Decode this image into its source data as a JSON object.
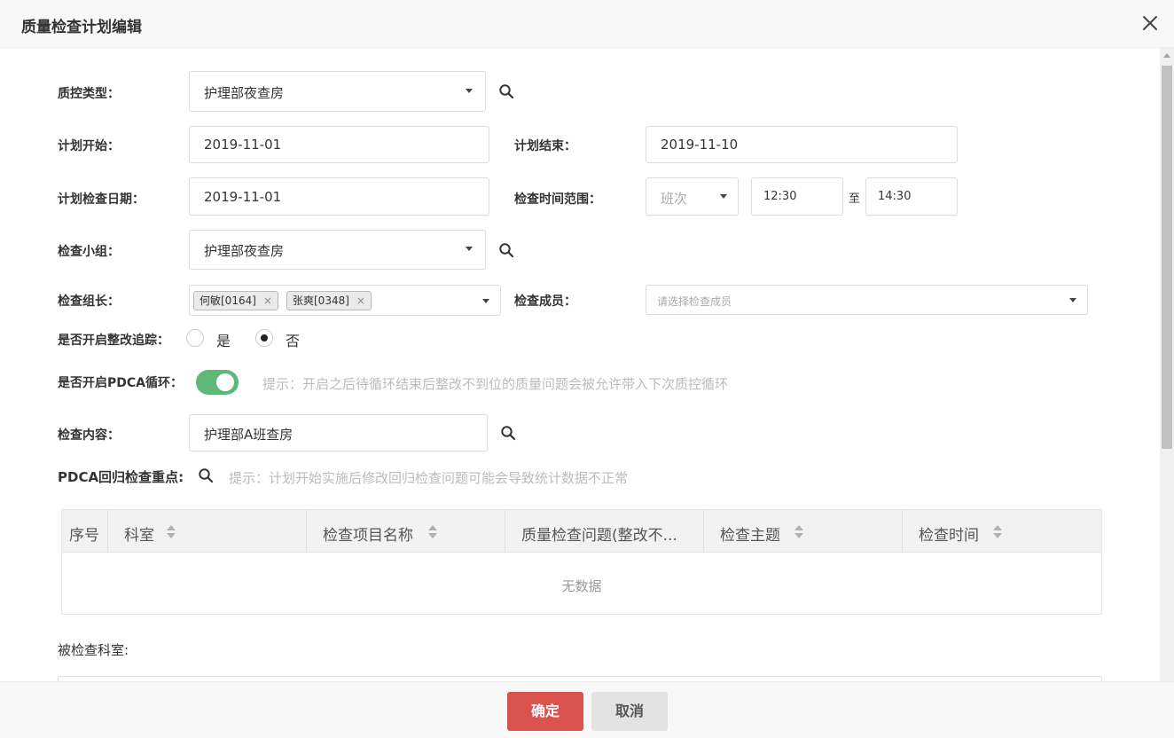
{
  "header": {
    "title": "质量检查计划编辑"
  },
  "form": {
    "qc_type": {
      "label": "质控类型：",
      "value": "护理部夜查房"
    },
    "plan_start": {
      "label": "计划开始：",
      "value": "2019-11-01"
    },
    "plan_end": {
      "label": "计划结束：",
      "value": "2019-11-10"
    },
    "plan_check_date": {
      "label": "计划检查日期：",
      "value": "2019-11-01"
    },
    "check_time_range": {
      "label": "检查时间范围：",
      "shift_placeholder": "班次",
      "start": "12:30",
      "separator": "至",
      "end": "14:30"
    },
    "check_group": {
      "label": "检查小组：",
      "value": "护理部夜查房"
    },
    "group_leader": {
      "label": "检查组长：",
      "tags": [
        "何敏[0164]",
        "张爽[0348]"
      ],
      "tag_remove": "×"
    },
    "group_members": {
      "label": "检查成员：",
      "placeholder": "请选择检查成员"
    },
    "rectify_tracking": {
      "label": "是否开启整改追踪：",
      "yes": "是",
      "no": "否",
      "selected": "no"
    },
    "pdca_cycle": {
      "label": "是否开启PDCA循环：",
      "enabled": true,
      "hint": "提示：开启之后待循环结束后整改不到位的质量问题会被允许带入下次质控循环"
    },
    "check_content": {
      "label": "检查内容：",
      "value": "护理部A班查房"
    },
    "pdca_focus": {
      "label": "PDCA回归检查重点:",
      "hint": "提示：计划开始实施后修改回归检查问题可能会导致统计数据不正常"
    }
  },
  "table": {
    "columns": [
      "序号",
      "科室",
      "检查项目名称",
      "质量检查问题(整改不...",
      "检查主题",
      "检查时间"
    ],
    "empty_text": "无数据"
  },
  "inspected_dept": {
    "label": "被检查科室:"
  },
  "footer": {
    "confirm": "确定",
    "cancel": "取消"
  },
  "colors": {
    "confirm": "#d9534f",
    "switch_on": "#5fb878"
  }
}
